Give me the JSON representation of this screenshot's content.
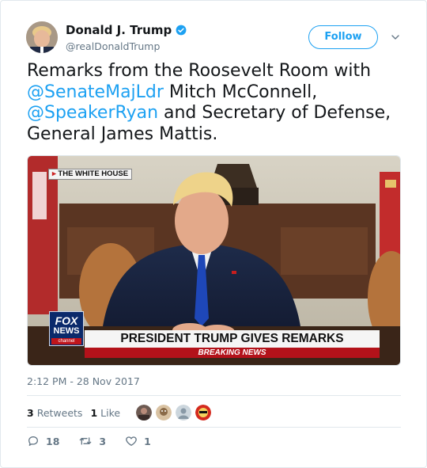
{
  "author": {
    "display_name": "Donald J. Trump",
    "handle": "@realDonaldTrump",
    "verified": true
  },
  "follow_label": "Follow",
  "tweet": {
    "segments": [
      {
        "text": "Remarks from the Roosevelt Room with ",
        "type": "text"
      },
      {
        "text": "@SenateMajLdr",
        "type": "mention"
      },
      {
        "text": " Mitch McConnell, ",
        "type": "text"
      },
      {
        "text": "@SpeakerRyan",
        "type": "mention"
      },
      {
        "text": " and Secretary of Defense, General James Mattis.",
        "type": "text"
      }
    ]
  },
  "media": {
    "bug_label": "THE WHITE HOUSE",
    "network_logo_top": "FOX",
    "network_logo_mid": "NEWS",
    "network_logo_bottom": "channel",
    "headline": "PRESIDENT TRUMP GIVES REMARKS",
    "subheadline": "BREAKING NEWS"
  },
  "timestamp": "2:12 PM - 28 Nov 2017",
  "stats": {
    "retweets_count": "3",
    "retweets_label": "Retweets",
    "likes_count": "1",
    "likes_label": "Like"
  },
  "actions": {
    "reply_count": "18",
    "retweet_count": "3",
    "like_count": "1"
  },
  "colors": {
    "accent": "#1da1f2",
    "muted": "#657786",
    "text": "#14171a"
  },
  "icons": [
    "verified-badge-icon",
    "chevron-down-icon",
    "reply-icon",
    "retweet-icon",
    "heart-icon"
  ]
}
